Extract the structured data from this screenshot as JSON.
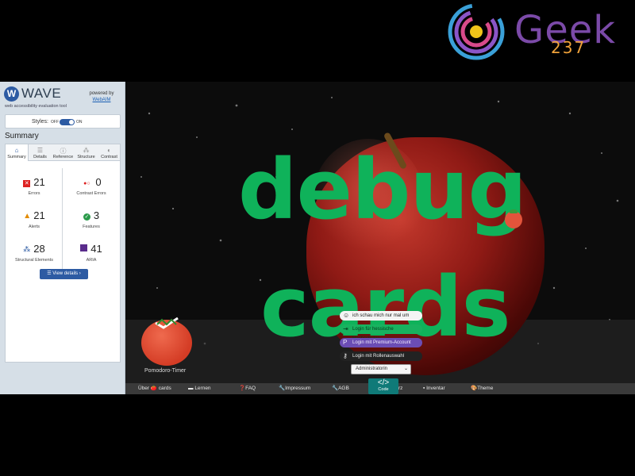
{
  "brand": {
    "name": "Geek",
    "number": "237"
  },
  "wave": {
    "title": "WAVE",
    "tagline": "web accessibility evaluation tool",
    "powered_by": "powered by",
    "powered_link": "WebAIM",
    "styles_label": "Styles:",
    "styles_off": "OFF",
    "styles_on": "ON",
    "summary_heading": "Summary",
    "tabs": [
      {
        "label": "Summary",
        "icon": "home-icon"
      },
      {
        "label": "Details",
        "icon": "list-icon"
      },
      {
        "label": "Reference",
        "icon": "info-icon"
      },
      {
        "label": "Structure",
        "icon": "structure-icon"
      },
      {
        "label": "Contrast",
        "icon": "contrast-icon"
      }
    ],
    "metrics": [
      {
        "count": "21",
        "label": "Errors",
        "icon": "error-icon"
      },
      {
        "count": "0",
        "label": "Contrast Errors",
        "icon": "contrast-error-icon"
      },
      {
        "count": "21",
        "label": "Alerts",
        "icon": "alert-icon"
      },
      {
        "count": "3",
        "label": "Features",
        "icon": "feature-icon"
      },
      {
        "count": "28",
        "label": "Structural Elements",
        "icon": "structural-icon"
      },
      {
        "count": "41",
        "label": "ARIA",
        "icon": "aria-icon"
      }
    ],
    "view_details": "View details ›",
    "colors": {
      "accent": "#2d5ba3"
    }
  },
  "hero": {
    "title_line1": "debug",
    "title_line2": "cards",
    "title_color": "#0fb25a"
  },
  "pomodoro": {
    "label": "Pomodoro-Timer"
  },
  "login": {
    "options": [
      {
        "label": "ich schau mich nur mal um",
        "icon": "smile-icon"
      },
      {
        "label": "Login für hessische Hochschulen",
        "icon": "login-icon"
      },
      {
        "label": "Login mit Premium-Account",
        "icon": "paypal-icon"
      },
      {
        "label": "Login mit Rollenauswahl",
        "icon": "key-icon"
      }
    ],
    "role_select": "Administratorin"
  },
  "nav": {
    "items": [
      {
        "label": "Über 🍅 cards",
        "icon": ""
      },
      {
        "label": "Lernen",
        "icon": "grad-cap-icon"
      },
      {
        "label": "FAQ",
        "icon": "question-icon"
      },
      {
        "label": "Impressum",
        "icon": "wrench-icon"
      },
      {
        "label": "AGB",
        "icon": "wrench-icon"
      },
      {
        "label": "rz",
        "icon": ""
      },
      {
        "label": "Inventar",
        "icon": "box-icon"
      },
      {
        "label": "Theme",
        "icon": "palette-icon"
      }
    ],
    "code_button": "Code"
  }
}
